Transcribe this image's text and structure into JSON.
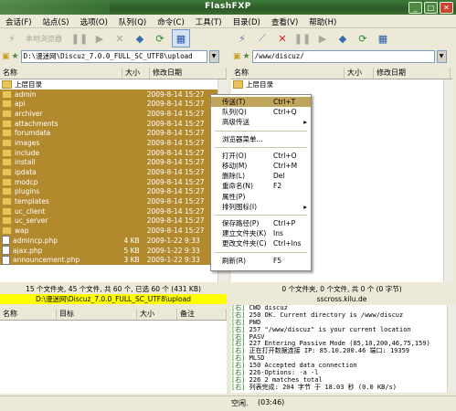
{
  "window": {
    "title": "FlashFXP"
  },
  "menu": [
    "会话(F)",
    "站点(S)",
    "选项(O)",
    "队列(Q)",
    "命令(C)",
    "工具(T)",
    "目录(D)",
    "查看(V)",
    "帮助(H)"
  ],
  "left_toolbar": {
    "connect_label": "本地浏览器"
  },
  "left_pane": {
    "path": "D:\\漫迷网\\Discuz_7.0.0_FULL_SC_UTF8\\upload",
    "col_name": "名称",
    "col_size": "大小",
    "col_date": "修改日期",
    "parent": "上层目录",
    "rows": [
      {
        "name": "admin",
        "size": "",
        "date": "2009-8-14 15:27",
        "type": "folder"
      },
      {
        "name": "api",
        "size": "",
        "date": "2009-8-14 15:27",
        "type": "folder"
      },
      {
        "name": "archiver",
        "size": "",
        "date": "2009-8-14 15:27",
        "type": "folder"
      },
      {
        "name": "attachments",
        "size": "",
        "date": "2009-8-14 15:27",
        "type": "folder"
      },
      {
        "name": "forumdata",
        "size": "",
        "date": "2009-8-14 15:27",
        "type": "folder"
      },
      {
        "name": "images",
        "size": "",
        "date": "2009-8-14 15:27",
        "type": "folder"
      },
      {
        "name": "include",
        "size": "",
        "date": "2009-8-14 15:27",
        "type": "folder"
      },
      {
        "name": "install",
        "size": "",
        "date": "2009-8-14 15:27",
        "type": "folder"
      },
      {
        "name": "ipdata",
        "size": "",
        "date": "2009-8-14 15:27",
        "type": "folder"
      },
      {
        "name": "modcp",
        "size": "",
        "date": "2009-8-14 15:27",
        "type": "folder"
      },
      {
        "name": "plugins",
        "size": "",
        "date": "2009-8-14 15:27",
        "type": "folder"
      },
      {
        "name": "templates",
        "size": "",
        "date": "2009-8-14 15:27",
        "type": "folder"
      },
      {
        "name": "uc_client",
        "size": "",
        "date": "2009-8-14 15:27",
        "type": "folder"
      },
      {
        "name": "uc_server",
        "size": "",
        "date": "2009-8-14 15:27",
        "type": "folder"
      },
      {
        "name": "wap",
        "size": "",
        "date": "2009-8-14 15:27",
        "type": "folder"
      },
      {
        "name": "admincp.php",
        "size": "4 KB",
        "date": "2009-1-22 9:33",
        "type": "file"
      },
      {
        "name": "ajax.php",
        "size": "5 KB",
        "date": "2009-1-22 9:33",
        "type": "file"
      },
      {
        "name": "announcement.php",
        "size": "3 KB",
        "date": "2009-1-22 9:33",
        "type": "file"
      }
    ],
    "status": "15 个文件夹, 45 个文件, 共 60 个, 已选 60 个 (431 KB)",
    "current_path": "D:\\漫迷网\\Discuz_7.0.0_FULL_SC_UTF8\\upload"
  },
  "right_pane": {
    "path": "/www/discuz/",
    "col_name": "名称",
    "col_size": "大小",
    "col_date": "修改日期",
    "parent": "上层目录",
    "status": "0 个文件夹, 0 个文件, 共 0 个 (0 字节)",
    "server": "sscross.kilu.de"
  },
  "context_menu": [
    {
      "label": "传送(T)",
      "shortcut": "Ctrl+T",
      "submenu": false,
      "highlight": true
    },
    {
      "label": "队列(Q)",
      "shortcut": "Ctrl+Q",
      "submenu": false,
      "highlight": false
    },
    {
      "label": "高级传送",
      "shortcut": "",
      "submenu": true,
      "highlight": false
    },
    {
      "sep": true
    },
    {
      "label": "浏览器菜单...",
      "shortcut": "",
      "submenu": false,
      "highlight": false
    },
    {
      "sep": true
    },
    {
      "label": "打开(O)",
      "shortcut": "Ctrl+O",
      "submenu": false,
      "highlight": false
    },
    {
      "label": "移动(M)",
      "shortcut": "Ctrl+M",
      "submenu": false,
      "highlight": false
    },
    {
      "label": "删除(L)",
      "shortcut": "Del",
      "submenu": false,
      "highlight": false
    },
    {
      "label": "重命名(N)",
      "shortcut": "F2",
      "submenu": false,
      "highlight": false
    },
    {
      "label": "属性(P)",
      "shortcut": "",
      "submenu": false,
      "highlight": false
    },
    {
      "label": "排列图标(I)",
      "shortcut": "",
      "submenu": true,
      "highlight": false
    },
    {
      "sep": true
    },
    {
      "label": "保存路径(P)",
      "shortcut": "Ctrl+P",
      "submenu": false,
      "highlight": false
    },
    {
      "label": "建立文件夹(K)",
      "shortcut": "Ins",
      "submenu": false,
      "highlight": false
    },
    {
      "label": "更改文件夹(C)",
      "shortcut": "Ctrl+Ins",
      "submenu": false,
      "highlight": false
    },
    {
      "sep": true
    },
    {
      "label": "刷新(R)",
      "shortcut": "F5",
      "submenu": false,
      "highlight": false
    }
  ],
  "queue": {
    "col_name": "名称",
    "col_target": "目标",
    "col_size": "大小",
    "col_note": "备注"
  },
  "log": [
    {
      "pfx": "[右]",
      "text": "CWD discuz"
    },
    {
      "pfx": "[右]",
      "text": "250 OK. Current directory is /www/discuz"
    },
    {
      "pfx": "[右]",
      "text": "PWD"
    },
    {
      "pfx": "[右]",
      "text": "257 \"/www/discuz\" is your current location"
    },
    {
      "pfx": "[右]",
      "text": "PASV"
    },
    {
      "pfx": "[右]",
      "text": "227 Entering Passive Mode (85,10,200,46,75,159)"
    },
    {
      "pfx": "[右]",
      "text": "正在打开数据连接 IP: 85.10.200.46 端口: 19359"
    },
    {
      "pfx": "[右]",
      "text": "MLSD"
    },
    {
      "pfx": "[右]",
      "text": "150 Accepted data connection"
    },
    {
      "pfx": "[右]",
      "text": "226-Options: -a -l"
    },
    {
      "pfx": "[右]",
      "text": "226 2 matches total"
    },
    {
      "pfx": "[右]",
      "text": "列表完成: 204 字节 于 18.03 秒 (0.0 KB/s)"
    }
  ],
  "statusbar": {
    "state": "空闲.",
    "time": "(03:46)"
  },
  "colors": {
    "selection": "#b3892e",
    "titlebar": "#3e7a3a",
    "path_highlight": "#ffff00"
  }
}
